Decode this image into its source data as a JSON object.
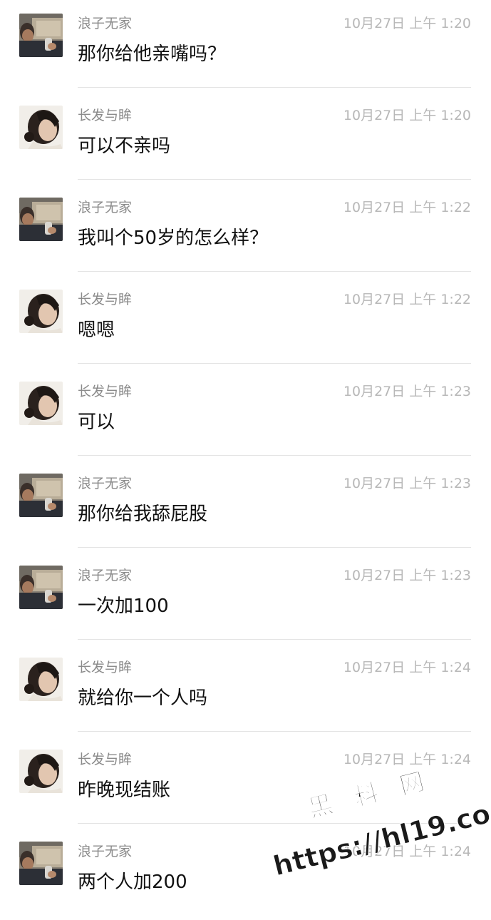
{
  "messages": [
    {
      "sender": "浪子无家",
      "avatar": "male-avatar",
      "time": "10月27日 上午 1:20",
      "text": "那你给他亲嘴吗？"
    },
    {
      "sender": "长发与眸",
      "avatar": "female-avatar",
      "time": "10月27日 上午 1:20",
      "text": "可以不亲吗"
    },
    {
      "sender": "浪子无家",
      "avatar": "male-avatar",
      "time": "10月27日 上午 1:22",
      "text": "我叫个50岁的怎么样？"
    },
    {
      "sender": "长发与眸",
      "avatar": "female-avatar",
      "time": "10月27日 上午 1:22",
      "text": "嗯嗯"
    },
    {
      "sender": "长发与眸",
      "avatar": "female-avatar",
      "time": "10月27日 上午 1:23",
      "text": "可以"
    },
    {
      "sender": "浪子无家",
      "avatar": "male-avatar",
      "time": "10月27日 上午 1:23",
      "text": "那你给我舔屁股"
    },
    {
      "sender": "浪子无家",
      "avatar": "male-avatar",
      "time": "10月27日 上午 1:23",
      "text": "一次加100"
    },
    {
      "sender": "长发与眸",
      "avatar": "female-avatar",
      "time": "10月27日 上午 1:24",
      "text": "就给你一个人吗"
    },
    {
      "sender": "长发与眸",
      "avatar": "female-avatar",
      "time": "10月27日 上午 1:24",
      "text": "昨晚现结账"
    },
    {
      "sender": "浪子无家",
      "avatar": "male-avatar",
      "time": "10月27日 上午 1:24",
      "text": "两个人加200"
    }
  ],
  "watermark": {
    "line1": "黑 料 网",
    "line2": "https://hl19.co"
  },
  "colors": {
    "sender": "#8a8a8a",
    "time": "#b7b7b7",
    "text": "#111111",
    "divider": "#e3e3e3"
  }
}
